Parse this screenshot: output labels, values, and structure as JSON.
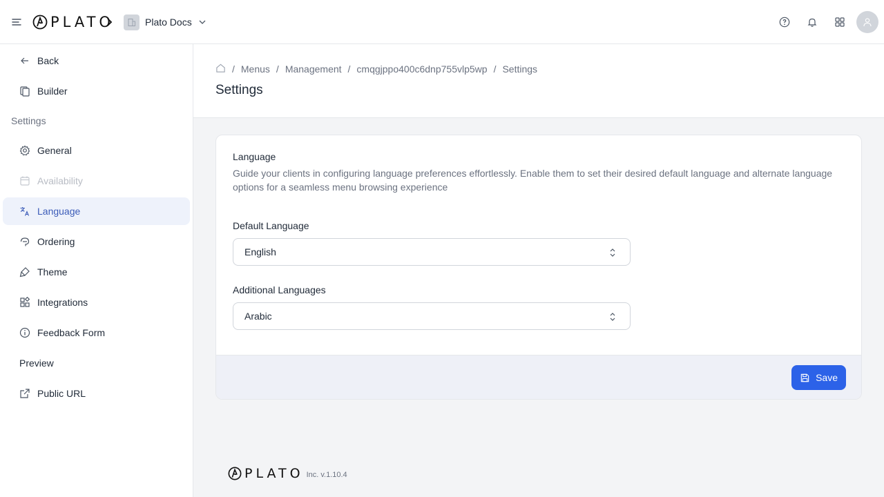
{
  "brand": {
    "name": "PLATO",
    "footer_name": "PLATO"
  },
  "topbar": {
    "workspace_name": "Plato Docs",
    "icons": [
      "menu-icon",
      "help-icon",
      "bell-icon",
      "apps-grid-icon",
      "user-avatar"
    ]
  },
  "sidebar": {
    "back_label": "Back",
    "builder_label": "Builder",
    "settings_section": "Settings",
    "items": [
      {
        "label": "General",
        "icon": "gear-icon"
      },
      {
        "label": "Availability",
        "icon": "calendar-icon",
        "disabled": true
      },
      {
        "label": "Language",
        "icon": "translate-icon",
        "active": true
      },
      {
        "label": "Ordering",
        "icon": "ordering-icon"
      },
      {
        "label": "Theme",
        "icon": "brush-icon"
      },
      {
        "label": "Integrations",
        "icon": "integrations-icon"
      },
      {
        "label": "Feedback Form",
        "icon": "info-icon"
      }
    ],
    "preview_section": "Preview",
    "public_url_label": "Public URL"
  },
  "breadcrumb": {
    "items": [
      "Menus",
      "Management",
      "cmqgjppo400c6dnp755vlp5wp",
      "Settings"
    ]
  },
  "page": {
    "title": "Settings"
  },
  "card": {
    "title": "Language",
    "description": "Guide your clients in configuring language preferences effortlessly. Enable them to set their desired default language and alternate language options for a seamless menu browsing experience",
    "default_language_label": "Default Language",
    "default_language_value": "English",
    "additional_languages_label": "Additional Languages",
    "additional_languages_value": "Arabic",
    "save_label": "Save"
  },
  "footer": {
    "version": "Inc. v.1.10.4"
  },
  "colors": {
    "primary": "#2c62e8",
    "active_bg": "#eef2fb",
    "active_text": "#3b5bb8"
  }
}
